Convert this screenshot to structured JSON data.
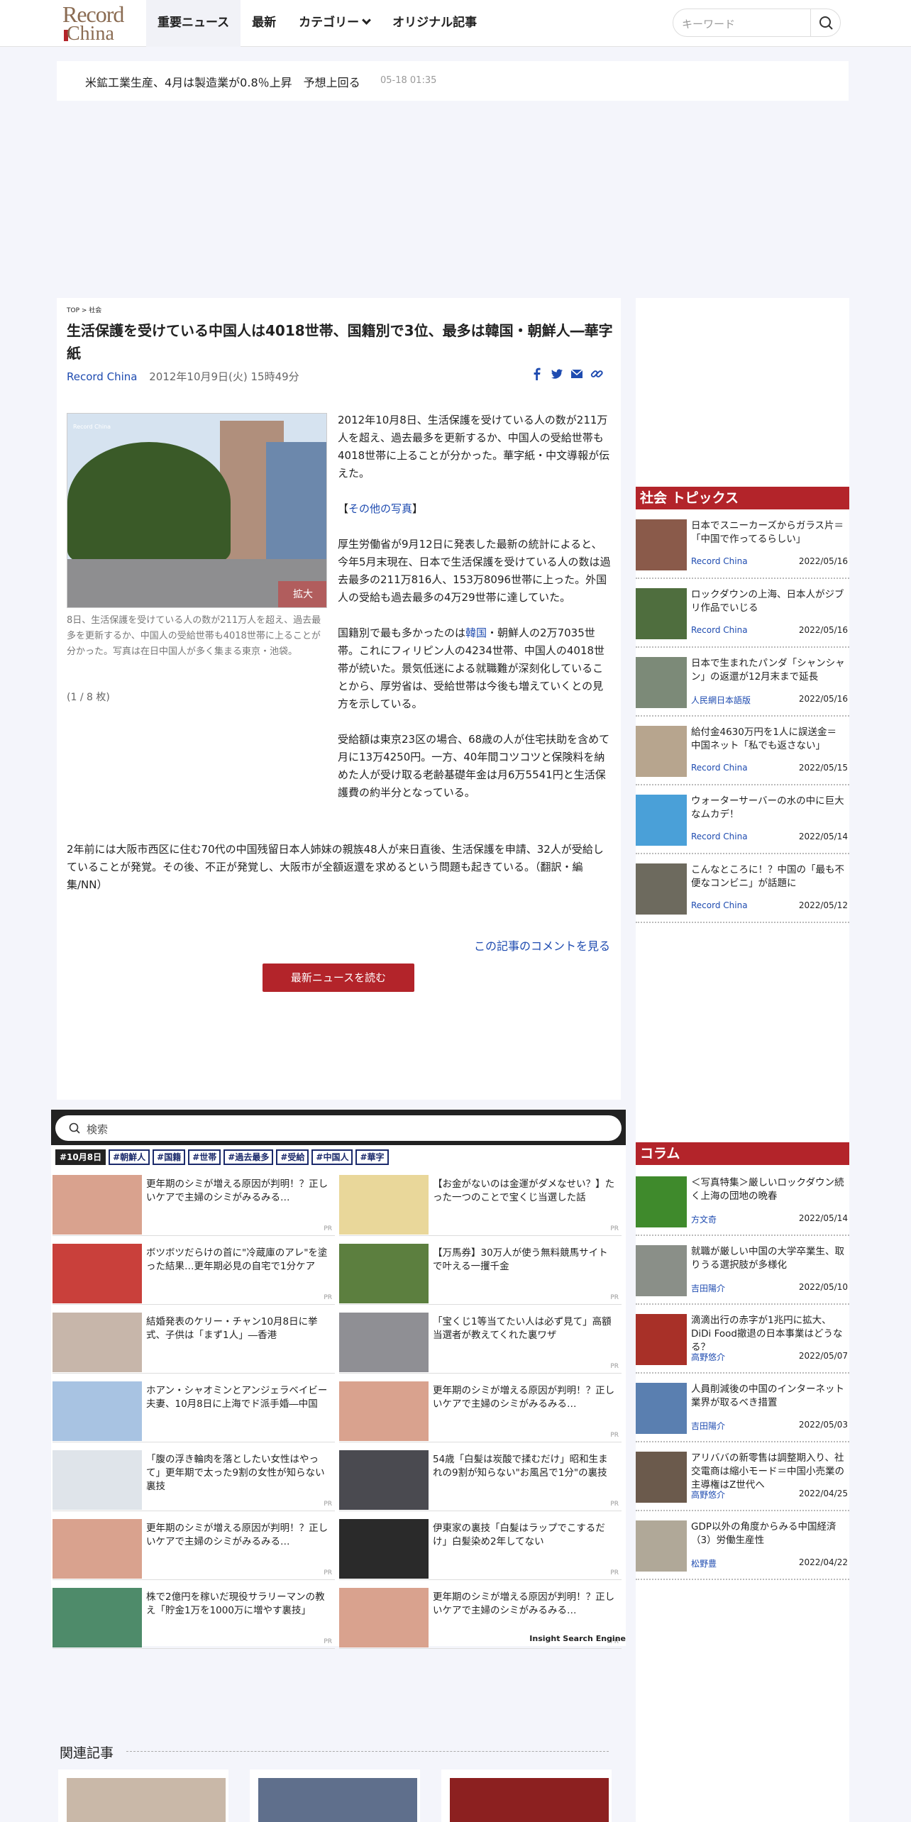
{
  "header": {
    "logo_line1": "Record",
    "logo_line2": "China",
    "nav": [
      "重要ニュース",
      "最新",
      "カテゴリー",
      "オリジナル記事"
    ],
    "search_placeholder": "キーワード"
  },
  "ticker": {
    "text": "米鉱工業生産、4月は製造業が0.8％上昇　予想上回る",
    "date": "05-18 01:35"
  },
  "article": {
    "breadcrumb": "TOP > 社会",
    "title": "生活保護を受けている中国人は4018世帯、国籍別で3位、最多は韓国・朝鮮人―華字紙",
    "source": "Record China",
    "date": "2012年10月9日(火) 15時49分",
    "photo_watermark": "Record China",
    "enlarge": "拡大",
    "caption": "8日、生活保護を受けている人の数が211万人を超え、過去最多を更新するか、中国人の受給世帯も4018世帯に上ることが分かった。写真は在日中国人が多く集まる東京・池袋。",
    "photo_count": "(1 / 8 枚)",
    "p1": "2012年10月8日、生活保護を受けている人の数が211万人を超え、過去最多を更新するか、中国人の受給世帯も4018世帯に上ることが分かった。華字紙・中文導報が伝えた。",
    "p2_pre": "【",
    "p2_link": "その他の写真",
    "p2_post": "】",
    "p3": "厚生労働省が9月12日に発表した最新の統計によると、今年5月末現在、日本で生活保護を受けている人の数は過去最多の211万816人、153万8096世帯に上った。外国人の受給も過去最多の4万29世帯に達していた。",
    "p4_pre": "国籍別で最も多かったのは",
    "p4_link": "韓国",
    "p4_post": "・朝鮮人の2万7035世帯。これにフィリピン人の4234世帯、中国人の4018世帯が続いた。景気低迷による就職難が深刻化していることから、厚労省は、受給世帯は今後も増えていくとの見方を示している。",
    "p5": "受給額は東京23区の場合、68歳の人が住宅扶助を含めて月に13万4250円。一方、40年間コツコツと保険料を納めた人が受け取る老齢基礎年金は月6万5541円と生活保護費の約半分となっている。",
    "p6": "2年前には大阪市西区に住む70代の中国残留日本人姉妹の親族48人が来日直後、生活保護を申請、32人が受給していることが発覚。その後、不正が発覚し、大阪市が全額返還を求めるという問題も起きている。（翻訳・編集/NN）",
    "comments_link": "この記事のコメントを見る",
    "read_button": "最新ニュースを読む"
  },
  "ise": {
    "search_placeholder": "検索",
    "tags": [
      "#10月8日",
      "#朝鮮人",
      "#国籍",
      "#世帯",
      "#過去最多",
      "#受給",
      "#中国人",
      "#華字"
    ],
    "items": [
      {
        "text": "更年期のシミが増える原因が判明！？正しいケアで主婦のシミがみるみる…",
        "pr": "PR"
      },
      {
        "text": "【お金がないのは金運がダメなせい？】たった一つのことで宝くじ当選した話",
        "pr": "PR"
      },
      {
        "text": "ボツボツだらけの首に\"冷蔵庫のアレ\"を塗った結果…更年期必見の自宅で1分ケア",
        "pr": "PR"
      },
      {
        "text": "【万馬券】30万人が使う無料競馬サイトで叶える一攫千金",
        "pr": "PR"
      },
      {
        "text": "結婚発表のケリー・チャン10月8日に挙式、子供は「まず1人」―香港",
        "pr": ""
      },
      {
        "text": "「宝くじ1等当てたい人は必ず見て」高額当選者が教えてくれた裏ワザ",
        "pr": "PR"
      },
      {
        "text": "ホアン・シャオミンとアンジェラベイビー夫妻、10月8日に上海でド派手婚―中国",
        "pr": ""
      },
      {
        "text": "更年期のシミが増える原因が判明！？正しいケアで主婦のシミがみるみる…",
        "pr": "PR"
      },
      {
        "text": "「腹の浮き輪肉を落としたい女性はやって」更年期で太った9割の女性が知らない裏技",
        "pr": "PR"
      },
      {
        "text": "54歳「白髪は炭酸で揉むだけ」昭和生まれの9割が知らない\"お風呂で1分\"の裏技",
        "pr": "PR"
      },
      {
        "text": "更年期のシミが増える原因が判明！？正しいケアで主婦のシミがみるみる…",
        "pr": "PR"
      },
      {
        "text": "伊東家の裏技「白髪はラップでこするだけ」白髪染め2年してない",
        "pr": "PR"
      },
      {
        "text": "株で2億円を稼いだ現役サラリーマンの教え「貯金1万を1000万に増やす裏技」",
        "pr": "PR"
      },
      {
        "text": "更年期のシミが増える原因が判明！？正しいケアで主婦のシミがみるみる…",
        "pr": "PR"
      }
    ],
    "brand": "Insight Search Engine"
  },
  "sidebar": {
    "topics_title": "社会 トピックス",
    "topics": [
      {
        "text": "日本でスニーカーズからガラス片＝「中国で作ってるらしい」",
        "source": "Record China",
        "date": "2022/05/16"
      },
      {
        "text": "ロックダウンの上海、日本人がジブリ作品でいじる",
        "source": "Record China",
        "date": "2022/05/16"
      },
      {
        "text": "日本で生まれたパンダ「シャンシャン」の返還が12月末まで延長",
        "source": "人民網日本語版",
        "date": "2022/05/16"
      },
      {
        "text": "給付金4630万円を1人に誤送金＝中国ネット「私でも返さない」",
        "source": "Record China",
        "date": "2022/05/15"
      },
      {
        "text": "ウォーターサーバーの水の中に巨大なムカデ！",
        "source": "Record China",
        "date": "2022/05/14"
      },
      {
        "text": "こんなところに！？中国の「最も不便なコンビニ」が話題に",
        "source": "Record China",
        "date": "2022/05/12"
      }
    ],
    "column_title": "コラム",
    "columns": [
      {
        "text": "＜写真特集＞厳しいロックダウン続く上海の団地の晩春",
        "source": "方文奇",
        "date": "2022/05/14"
      },
      {
        "text": "就職が厳しい中国の大学卒業生、取りうる選択肢が多様化",
        "source": "吉田陽介",
        "date": "2022/05/10"
      },
      {
        "text": "滴滴出行の赤字が1兆円に拡大、DiDi Food撤退の日本事業はどうなる？",
        "source": "高野悠介",
        "date": "2022/05/07"
      },
      {
        "text": "人員削減後の中国のインターネット業界が取るべき措置",
        "source": "吉田陽介",
        "date": "2022/05/03"
      },
      {
        "text": "アリババの新零售は調整期入り、社交電商は縮小モード＝中国小売業の主導権はZ世代へ",
        "source": "高野悠介",
        "date": "2022/04/25"
      },
      {
        "text": "GDP以外の角度からみる中国経済（3）労働生産性",
        "source": "松野豊",
        "date": "2022/04/22"
      }
    ]
  },
  "related": {
    "title": "関連記事"
  },
  "colors": {
    "accent": "#b3242a",
    "link": "#1e4bb0",
    "tag": "#1b2a6b"
  }
}
